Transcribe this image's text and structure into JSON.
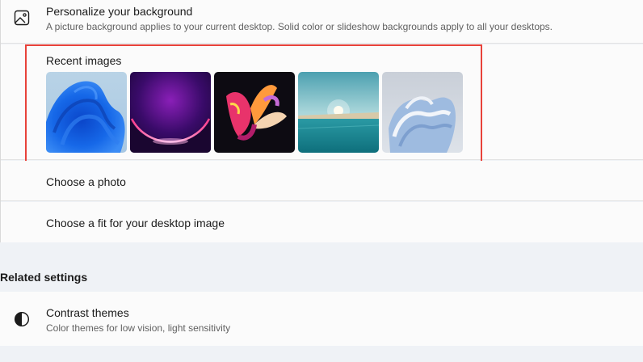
{
  "background_card": {
    "title": "Personalize your background",
    "description": "A picture background applies to your current desktop. Solid color or slideshow backgrounds apply to all your desktops.",
    "icon": "image-icon"
  },
  "recent_images": {
    "label": "Recent images",
    "highlight_color": "#e8423a",
    "thumbnails": [
      {
        "name": "blue-bloom-wallpaper"
      },
      {
        "name": "purple-glow-wallpaper"
      },
      {
        "name": "colorful-ribbon-wallpaper"
      },
      {
        "name": "lake-sunrise-wallpaper"
      },
      {
        "name": "silver-bloom-wallpaper"
      }
    ]
  },
  "choose_photo": {
    "label": "Choose a photo"
  },
  "choose_fit": {
    "label": "Choose a fit for your desktop image"
  },
  "related_settings": {
    "heading": "Related settings",
    "contrast": {
      "title": "Contrast themes",
      "description": "Color themes for low vision, light sensitivity",
      "icon": "contrast-icon"
    }
  }
}
